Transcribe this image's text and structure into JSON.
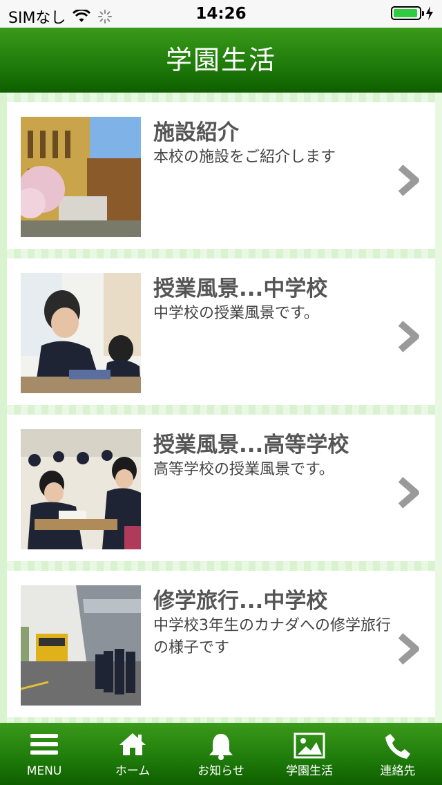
{
  "status_bar": {
    "carrier": "SIMなし",
    "time": "14:26"
  },
  "header": {
    "title": "学園生活"
  },
  "items": [
    {
      "title": "施設紹介",
      "description": "本校の施設をご紹介します",
      "image": "school-building"
    },
    {
      "title": "授業風景...中学校",
      "description": "中学校の授業風景です。",
      "image": "junior-high-class"
    },
    {
      "title": "授業風景...高等学校",
      "description": "高等学校の授業風景です。",
      "image": "high-school-class"
    },
    {
      "title": "修学旅行...中学校",
      "description": "中学校3年生のカナダへの修学旅行の様子です",
      "image": "school-trip"
    }
  ],
  "tabs": [
    {
      "label": "MENU",
      "icon": "menu-icon"
    },
    {
      "label": "ホーム",
      "icon": "home-icon"
    },
    {
      "label": "お知らせ",
      "icon": "bell-icon"
    },
    {
      "label": "学園生活",
      "icon": "picture-icon"
    },
    {
      "label": "連絡先",
      "icon": "phone-icon"
    }
  ],
  "colors": {
    "primary_green": "#1e7a0a",
    "background_stripe": "#d9f2d0",
    "chevron": "#9a9a9a"
  }
}
